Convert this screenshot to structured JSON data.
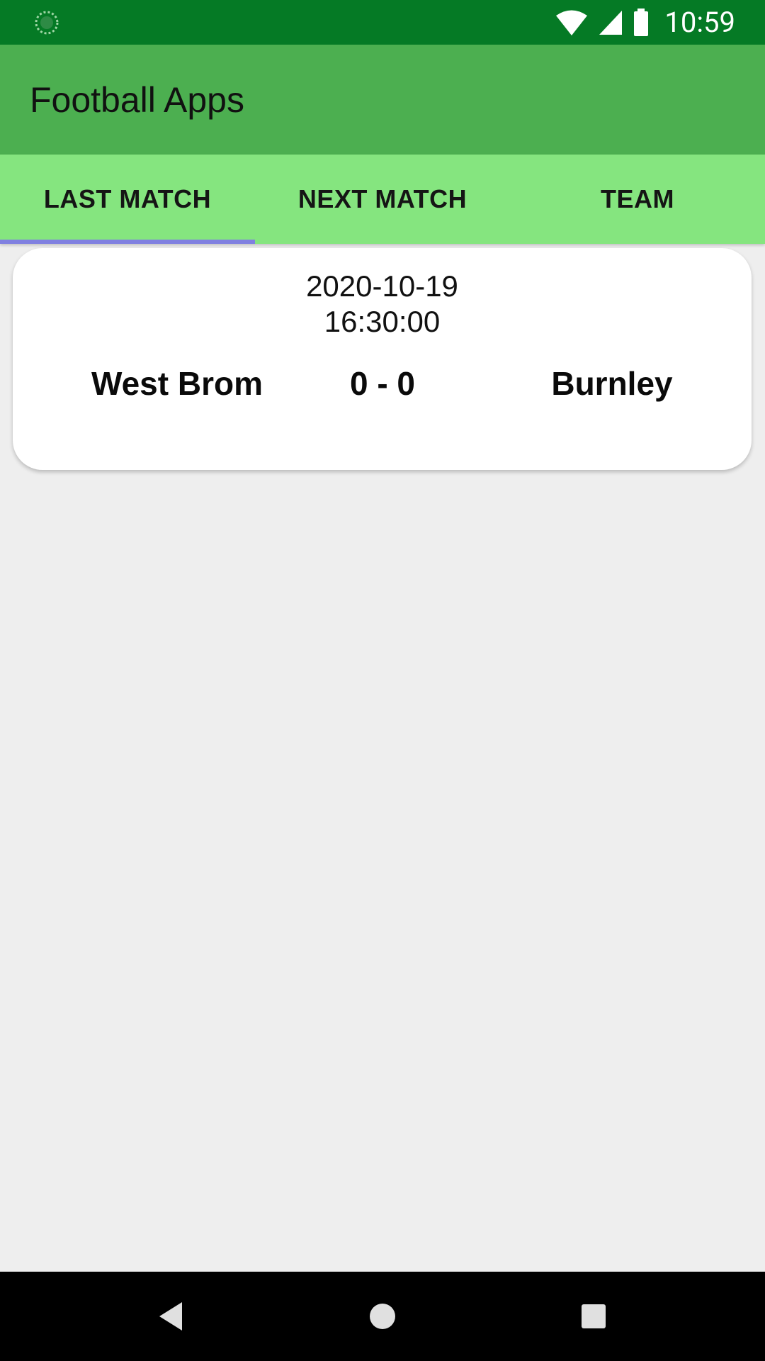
{
  "status_bar": {
    "time": "10:59",
    "icons": [
      "loading-spinner-icon",
      "wifi-icon",
      "signal-icon",
      "battery-icon"
    ]
  },
  "app_bar": {
    "title": "Football Apps",
    "color": "#4caf50"
  },
  "tabs": [
    {
      "label": "LAST MATCH",
      "selected": true
    },
    {
      "label": "NEXT MATCH",
      "selected": false
    },
    {
      "label": "TEAM",
      "selected": false
    }
  ],
  "match": {
    "date": "2020-10-19",
    "time": "16:30:00",
    "home_team": "West Brom",
    "score": "0 - 0",
    "away_team": "Burnley"
  },
  "nav_bar": {
    "icons": [
      "back-icon",
      "home-icon",
      "recents-icon"
    ]
  },
  "colors": {
    "status_bar": "#057a25",
    "tab_bar": "#85e57f",
    "tab_indicator": "#8080e0",
    "background": "#eeeeee"
  }
}
